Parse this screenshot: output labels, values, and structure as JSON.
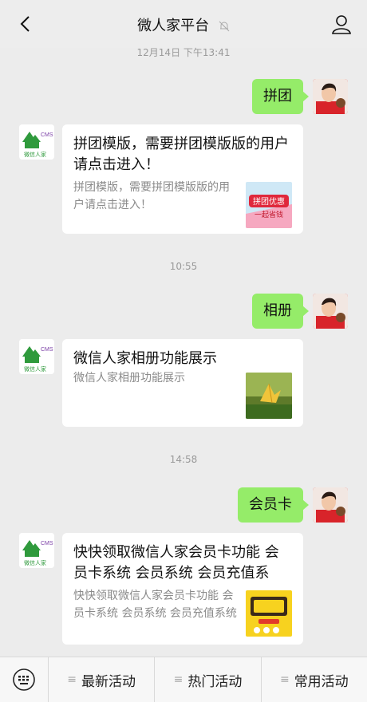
{
  "header": {
    "title": "微人家平台",
    "icons": [
      "back-icon",
      "mute-bell-icon",
      "profile-icon"
    ]
  },
  "messages": [
    {
      "timestamp": "12月14日 下午13:41",
      "sent": "拼团",
      "card": {
        "title": "拼团模版，需要拼团模版版的用户请点击进入！",
        "desc": "拼团模版，需要拼团模版版的用户请点击进入！"
      }
    },
    {
      "timestamp": "10:55",
      "sent": "相册",
      "card": {
        "title": "微信人家相册功能展示",
        "desc": "微信人家相册功能展示"
      }
    },
    {
      "timestamp": "14:58",
      "sent": "会员卡",
      "card": {
        "title": "快快领取微信人家会员卡功能 会员卡系统 会员系统 会员充值系",
        "desc": "快快领取微信人家会员卡功能 会员卡系统 会员系统 会员充值系统"
      }
    }
  ],
  "bot_logo": {
    "cms": "CMS",
    "name": "微信人家"
  },
  "thumb_text": {
    "group": "拼团优惠",
    "group_sub": "一起省钱"
  },
  "bottom_menu": {
    "items": [
      "最新活动",
      "热门活动",
      "常用活动"
    ],
    "lines_glyph": "≡"
  },
  "colors": {
    "sent_bubble": "#95ec69",
    "background": "#ececec",
    "logo_green": "#2f9a3c",
    "logo_purple": "#7b3fa6"
  }
}
